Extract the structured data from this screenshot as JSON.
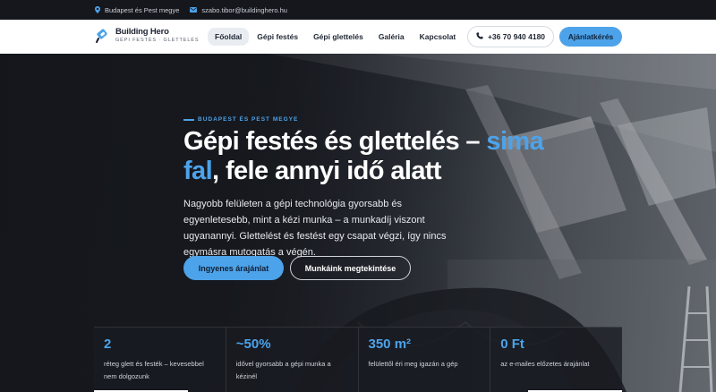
{
  "topbar": {
    "location": "Budapest és Pest megye",
    "email": "szabo.tibor@buildinghero.hu"
  },
  "brand": {
    "name": "Building Hero",
    "tagline": "GÉPI FESTÉS · GLETTELÉS"
  },
  "nav": {
    "items": [
      "Főoldal",
      "Gépi festés",
      "Gépi glettelés",
      "Galéria",
      "Kapcsolat"
    ],
    "active": "Főoldal"
  },
  "header": {
    "phone": "+36 70 940 4180",
    "quote_label": "Ajánlatkérés"
  },
  "hero": {
    "eyebrow": "BUDAPEST ÉS PEST MEGYE",
    "headline_part1": "Gépi festés és glettelés – ",
    "headline_accent1": "sima fal",
    "headline_part2": ", fele annyi idő alatt",
    "lead": "Nagyobb felületen a gépi technológia gyorsabb és egyenletesebb, mint a kézi munka – a munkadíj viszont ugyanannyi. Glettelést és festést egy csapat végzi, így nincs egymásra mutogatás a végén.",
    "cta_primary": "Ingyenes árajánlat",
    "cta_secondary": "Munkáink megtekintése"
  },
  "stats": [
    {
      "value": "2",
      "label": "réteg glett és festék – kevesebbel nem dolgozunk"
    },
    {
      "value": "~50%",
      "label": "idővel gyorsabb a gépi munka a kézinél"
    },
    {
      "value": "350 m²",
      "label": "felülettől éri meg igazán a gép"
    },
    {
      "value": "0 Ft",
      "label": "az e-mailes előzetes árajánlat"
    }
  ],
  "colors": {
    "accent": "#4da3ea",
    "dark": "#1a1d22",
    "header_bg": "#ffffff"
  }
}
